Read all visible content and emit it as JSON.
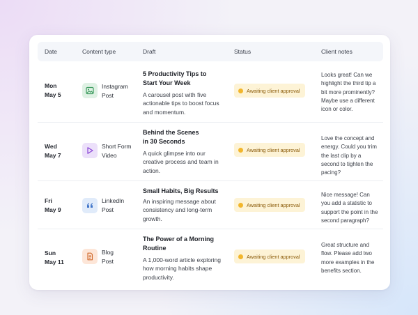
{
  "headers": {
    "date": "Date",
    "content_type": "Content type",
    "draft": "Draft",
    "status": "Status",
    "client_notes": "Client notes"
  },
  "rows": [
    {
      "day": "Mon",
      "date": "May 5",
      "type_line1": "Instagram",
      "type_line2": "Post",
      "icon": "image-icon",
      "title_line1": "5 Productivity Tips to",
      "title_line2": "Start Your Week",
      "body": "A carousel post with five actionable tips to boost focus and momentum.",
      "status": "Awaiting client approval",
      "notes": "Looks great! Can we highlight the third tip a bit more prominently? Maybe use a different icon or color."
    },
    {
      "day": "Wed",
      "date": "May 7",
      "type_line1": "Short Form",
      "type_line2": "Video",
      "icon": "play-icon",
      "title_line1": "Behind the Scenes",
      "title_line2": "in 30 Seconds",
      "body": "A quick glimpse into our creative process and team in action.",
      "status": "Awaiting client approval",
      "notes": "Love the concept and energy. Could you trim the last clip by a second to tighten the pacing?"
    },
    {
      "day": "Fri",
      "date": "May 9",
      "type_line1": "LinkedIn",
      "type_line2": "Post",
      "icon": "quote-icon",
      "title_line1": "Small Habits, Big Results",
      "title_line2": "",
      "body": "An inspiring message about consistency and long-term growth.",
      "status": "Awaiting client approval",
      "notes": "Nice message! Can you add a statistic to support the point in the second paragraph?"
    },
    {
      "day": "Sun",
      "date": "May 11",
      "type_line1": "Blog",
      "type_line2": "Post",
      "icon": "document-icon",
      "title_line1": "The Power of a Morning",
      "title_line2": "Routine",
      "body": "A 1,000-word article exploring how morning habits shape productivity.",
      "status": "Awaiting client approval",
      "notes": "Great structure and flow. Please add two more examples in the benefits section."
    }
  ],
  "colors": {
    "status_bg": "#fdf3d6",
    "status_dot": "#f2b62c",
    "instagram_icon_bg": "#dff1e4",
    "video_icon_bg": "#ece0fa",
    "linkedin_icon_bg": "#e0ebfa",
    "blog_icon_bg": "#fde6d8"
  }
}
